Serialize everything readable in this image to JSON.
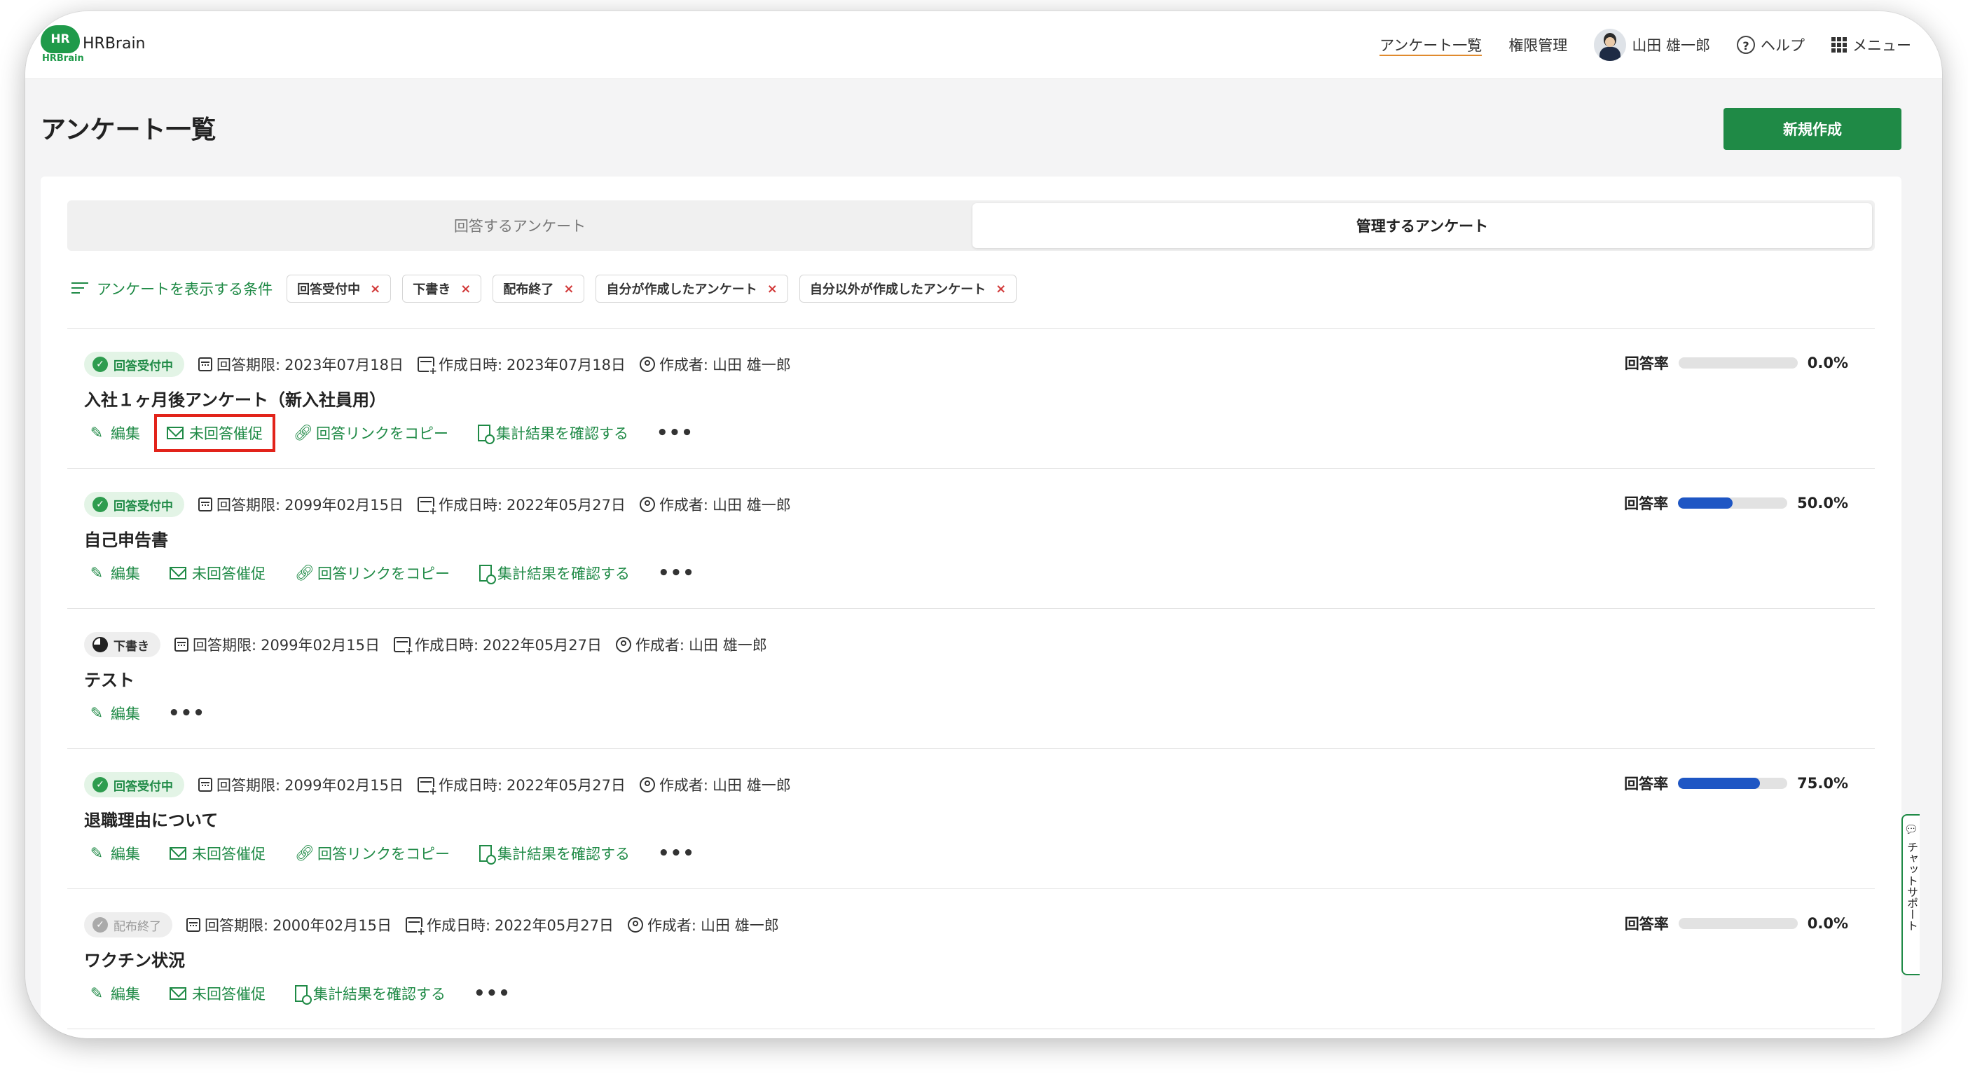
{
  "header": {
    "logo_mark": "HR",
    "logo_sub": "HRBrain",
    "app_name": "HRBrain",
    "nav": {
      "survey_list": "アンケート一覧",
      "permissions": "権限管理",
      "user_name": "山田 雄一郎",
      "help": "ヘルプ",
      "menu": "メニュー"
    }
  },
  "page": {
    "title": "アンケート一覧",
    "new_button": "新規作成"
  },
  "tabs": {
    "answer": "回答するアンケート",
    "manage": "管理するアンケート"
  },
  "filters": {
    "label": "アンケートを表示する条件",
    "chips": [
      "回答受付中",
      "下書き",
      "配布終了",
      "自分が作成したアンケート",
      "自分以外が作成したアンケート"
    ]
  },
  "labels": {
    "deadline_prefix": "回答期限:",
    "created_prefix": "作成日時:",
    "author_prefix": "作成者:",
    "rate": "回答率",
    "edit": "編集",
    "remind": "未回答催促",
    "copy_link": "回答リンクをコピー",
    "results": "集計結果を確認する",
    "more": "•••"
  },
  "surveys": [
    {
      "status": "回答受付中",
      "status_type": "open",
      "deadline": "2023年07月18日",
      "created": "2023年07月18日",
      "author": "山田 雄一郎",
      "title": "入社１ヶ月後アンケート（新入社員用）",
      "rate_value": 0.0,
      "rate_text": "0.0%"
    },
    {
      "status": "回答受付中",
      "status_type": "open",
      "deadline": "2099年02月15日",
      "created": "2022年05月27日",
      "author": "山田 雄一郎",
      "title": "自己申告書",
      "rate_value": 50.0,
      "rate_text": "50.0%"
    },
    {
      "status": "下書き",
      "status_type": "draft",
      "deadline": "2099年02月15日",
      "created": "2022年05月27日",
      "author": "山田 雄一郎",
      "title": "テスト"
    },
    {
      "status": "回答受付中",
      "status_type": "open",
      "deadline": "2099年02月15日",
      "created": "2022年05月27日",
      "author": "山田 雄一郎",
      "title": "退職理由について",
      "rate_value": 75.0,
      "rate_text": "75.0%"
    },
    {
      "status": "配布終了",
      "status_type": "closed",
      "deadline": "2000年02月15日",
      "created": "2022年05月27日",
      "author": "山田 雄一郎",
      "title": "ワクチン状況",
      "rate_value": 0.0,
      "rate_text": "0.0%"
    }
  ],
  "chat_support": "チャットサポート",
  "colors": {
    "brand_green": "#1f8a46",
    "progress_blue": "#1e56c4",
    "highlight_red": "#e2231a",
    "nav_underline": "#e08a2e"
  }
}
